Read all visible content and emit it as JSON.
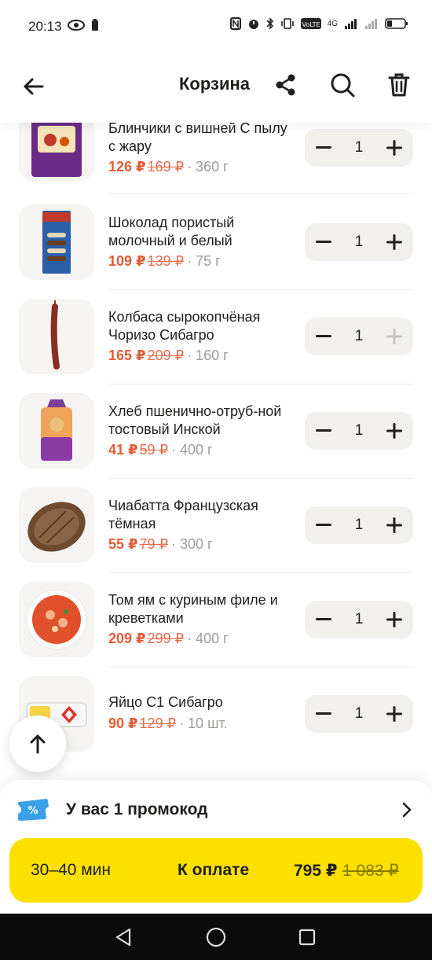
{
  "status": {
    "time": "20:13",
    "network": "4G"
  },
  "header": {
    "title": "Корзина"
  },
  "items": [
    {
      "title": "Блинчики с вишней С пылу с жару",
      "price": "126 ₽",
      "old_price": "169 ₽",
      "weight": "· 360 г",
      "qty": "1",
      "img": "pancakes-pack",
      "plus_disabled": false
    },
    {
      "title": "Шоколад пористый молочный и белый",
      "price": "109 ₽",
      "old_price": "139 ₽",
      "weight": "· 75 г",
      "qty": "1",
      "img": "chocolate-bar",
      "plus_disabled": false
    },
    {
      "title": "Колбаса сырокопчёная Чоризо Сибагро",
      "price": "165 ₽",
      "old_price": "209 ₽",
      "weight": "· 160 г",
      "qty": "1",
      "img": "sausage",
      "plus_disabled": true
    },
    {
      "title": "Хлеб пшенично-отруб-ной тостовый Инской",
      "price": "41 ₽",
      "old_price": "59 ₽",
      "weight": "· 400 г",
      "qty": "1",
      "img": "toast-bread-bag",
      "plus_disabled": false
    },
    {
      "title": "Чиабатта Французская тёмная",
      "price": "55 ₽",
      "old_price": "79 ₽",
      "weight": "· 300 г",
      "qty": "1",
      "img": "ciabatta",
      "plus_disabled": false
    },
    {
      "title": "Том ям с куриным филе и креветками",
      "price": "209 ₽",
      "old_price": "299 ₽",
      "weight": "· 400 г",
      "qty": "1",
      "img": "tom-yam-bowl",
      "plus_disabled": false
    },
    {
      "title": "Яйцо С1 Сибагро",
      "price": "90 ₽",
      "old_price": "129 ₽",
      "weight": "· 10 шт.",
      "qty": "1",
      "img": "eggs-box",
      "plus_disabled": false
    }
  ],
  "promo": {
    "text": "У вас 1 промокод"
  },
  "checkout": {
    "time": "30–40 мин",
    "label": "К оплате",
    "total": "795 ₽",
    "old_total": "1 083 ₽"
  },
  "colors": {
    "accent_yellow": "#fce000",
    "price_red": "#e25c37",
    "stepper_bg": "#f2f0ed"
  }
}
